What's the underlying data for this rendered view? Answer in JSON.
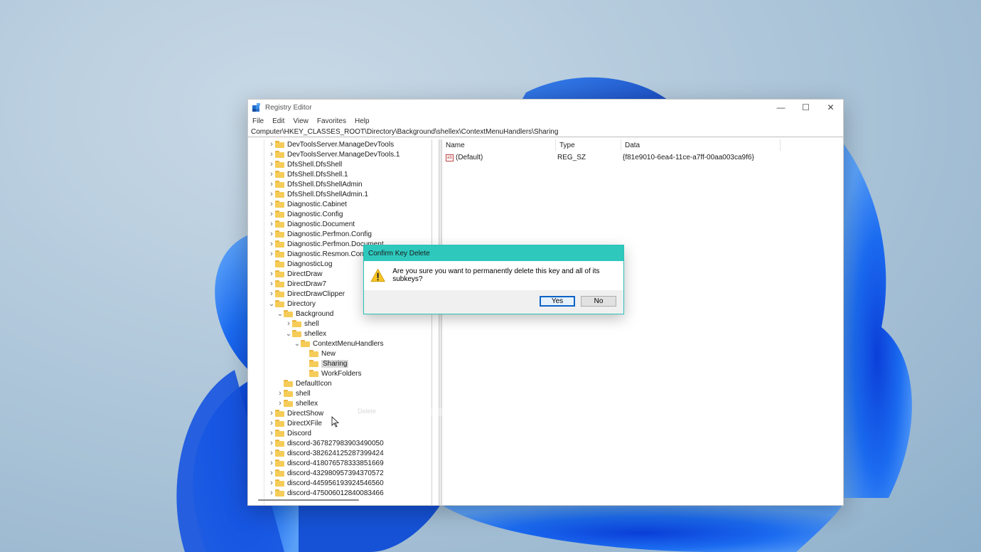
{
  "window": {
    "title": "Registry Editor",
    "controls": {
      "minimize": "—",
      "maximize": "☐",
      "close": "✕"
    }
  },
  "menu": [
    "File",
    "Edit",
    "View",
    "Favorites",
    "Help"
  ],
  "address": "Computer\\HKEY_CLASSES_ROOT\\Directory\\Background\\shellex\\ContextMenuHandlers\\Sharing",
  "tree": [
    {
      "label": "DevToolsServer.ManageDevTools",
      "depth": 0,
      "expander": "collapsed"
    },
    {
      "label": "DevToolsServer.ManageDevTools.1",
      "depth": 0,
      "expander": "collapsed"
    },
    {
      "label": "DfsShell.DfsShell",
      "depth": 0,
      "expander": "collapsed"
    },
    {
      "label": "DfsShell.DfsShell.1",
      "depth": 0,
      "expander": "collapsed"
    },
    {
      "label": "DfsShell.DfsShellAdmin",
      "depth": 0,
      "expander": "collapsed"
    },
    {
      "label": "DfsShell.DfsShellAdmin.1",
      "depth": 0,
      "expander": "collapsed"
    },
    {
      "label": "Diagnostic.Cabinet",
      "depth": 0,
      "expander": "collapsed"
    },
    {
      "label": "Diagnostic.Config",
      "depth": 0,
      "expander": "collapsed"
    },
    {
      "label": "Diagnostic.Document",
      "depth": 0,
      "expander": "collapsed"
    },
    {
      "label": "Diagnostic.Perfmon.Config",
      "depth": 0,
      "expander": "collapsed"
    },
    {
      "label": "Diagnostic.Perfmon.Document",
      "depth": 0,
      "expander": "collapsed"
    },
    {
      "label": "Diagnostic.Resmon.Config",
      "depth": 0,
      "expander": "collapsed"
    },
    {
      "label": "DiagnosticLog",
      "depth": 0,
      "expander": "none"
    },
    {
      "label": "DirectDraw",
      "depth": 0,
      "expander": "collapsed"
    },
    {
      "label": "DirectDraw7",
      "depth": 0,
      "expander": "collapsed"
    },
    {
      "label": "DirectDrawClipper",
      "depth": 0,
      "expander": "collapsed"
    },
    {
      "label": "Directory",
      "depth": 0,
      "expander": "expanded"
    },
    {
      "label": "Background",
      "depth": 1,
      "expander": "expanded"
    },
    {
      "label": "shell",
      "depth": 2,
      "expander": "collapsed"
    },
    {
      "label": "shellex",
      "depth": 2,
      "expander": "expanded"
    },
    {
      "label": "ContextMenuHandlers",
      "depth": 3,
      "expander": "expanded"
    },
    {
      "label": "New",
      "depth": 4,
      "expander": "none"
    },
    {
      "label": "Sharing",
      "depth": 4,
      "expander": "none",
      "selected": true
    },
    {
      "label": "WorkFolders",
      "depth": 4,
      "expander": "none"
    },
    {
      "label": "DefaultIcon",
      "depth": 1,
      "expander": "none"
    },
    {
      "label": "shell",
      "depth": 1,
      "expander": "collapsed"
    },
    {
      "label": "shellex",
      "depth": 1,
      "expander": "collapsed"
    },
    {
      "label": "DirectShow",
      "depth": 0,
      "expander": "collapsed"
    },
    {
      "label": "DirectXFile",
      "depth": 0,
      "expander": "collapsed"
    },
    {
      "label": "Discord",
      "depth": 0,
      "expander": "collapsed"
    },
    {
      "label": "discord-367827983903490050",
      "depth": 0,
      "expander": "collapsed"
    },
    {
      "label": "discord-382624125287399424",
      "depth": 0,
      "expander": "collapsed"
    },
    {
      "label": "discord-418076578333851669",
      "depth": 0,
      "expander": "collapsed"
    },
    {
      "label": "discord-432980957394370572",
      "depth": 0,
      "expander": "collapsed"
    },
    {
      "label": "discord-445956193924546560",
      "depth": 0,
      "expander": "collapsed"
    },
    {
      "label": "discord-475006012840083466",
      "depth": 0,
      "expander": "collapsed"
    }
  ],
  "values": {
    "columns": [
      "Name",
      "Type",
      "Data"
    ],
    "rows": [
      {
        "name": "(Default)",
        "type": "REG_SZ",
        "data": "{f81e9010-6ea4-11ce-a7ff-00aa003ca9f6}"
      }
    ]
  },
  "ghost_menu": "Delete",
  "dialog": {
    "title": "Confirm Key Delete",
    "message": "Are you sure you want to permanently delete this key and all of its subkeys?",
    "yes_label": "Yes",
    "no_label": "No"
  },
  "colors": {
    "dialog_title": "#2ec8bd",
    "folder": "#f5cc58",
    "selection": "#d9d9d9",
    "default_button_border": "#0a64c8"
  }
}
